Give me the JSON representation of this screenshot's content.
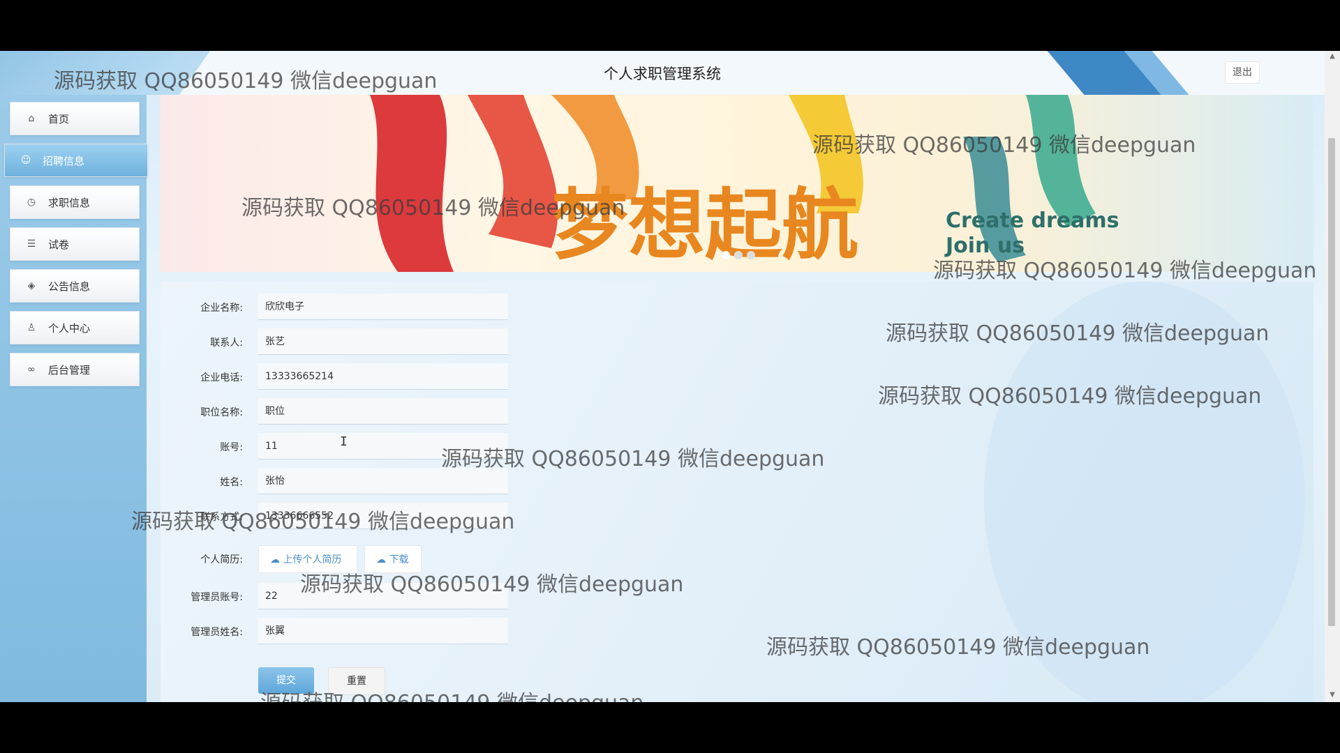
{
  "header": {
    "title": "个人求职管理系统",
    "logout_label": "退出"
  },
  "sidebar": {
    "items": [
      {
        "label": "首页",
        "icon": "home-icon",
        "glyph": "⌂",
        "active": false
      },
      {
        "label": "招聘信息",
        "icon": "palette-icon",
        "glyph": "☺",
        "active": true
      },
      {
        "label": "求职信息",
        "icon": "clock-icon",
        "glyph": "◷",
        "active": false
      },
      {
        "label": "试卷",
        "icon": "sliders-icon",
        "glyph": "☰",
        "active": false
      },
      {
        "label": "公告信息",
        "icon": "layers-icon",
        "glyph": "◈",
        "active": false
      },
      {
        "label": "个人中心",
        "icon": "user-icon",
        "glyph": "♙",
        "active": false
      },
      {
        "label": "后台管理",
        "icon": "link-icon",
        "glyph": "∞",
        "active": false
      }
    ]
  },
  "banner": {
    "heading": "梦想起航",
    "en_line1": "Create dreams",
    "en_line2": "Join us"
  },
  "form": {
    "fields": [
      {
        "label": "企业名称:",
        "value": "欣欣电子"
      },
      {
        "label": "联系人:",
        "value": "张艺"
      },
      {
        "label": "企业电话:",
        "value": "13333665214"
      },
      {
        "label": "职位名称:",
        "value": "职位"
      },
      {
        "label": "账号:",
        "value": "11"
      },
      {
        "label": "姓名:",
        "value": "张怡"
      },
      {
        "label": "联系方式:",
        "value": "13336666552"
      }
    ],
    "resume_label": "个人简历:",
    "upload_label": "上传个人简历",
    "download_label": "下载",
    "admin_fields": [
      {
        "label": "管理员账号:",
        "value": "22"
      },
      {
        "label": "管理员姓名:",
        "value": "张翼"
      }
    ],
    "submit_label": "提交",
    "reset_label": "重置"
  },
  "watermark": "源码获取 QQ86050149 微信deepguan"
}
